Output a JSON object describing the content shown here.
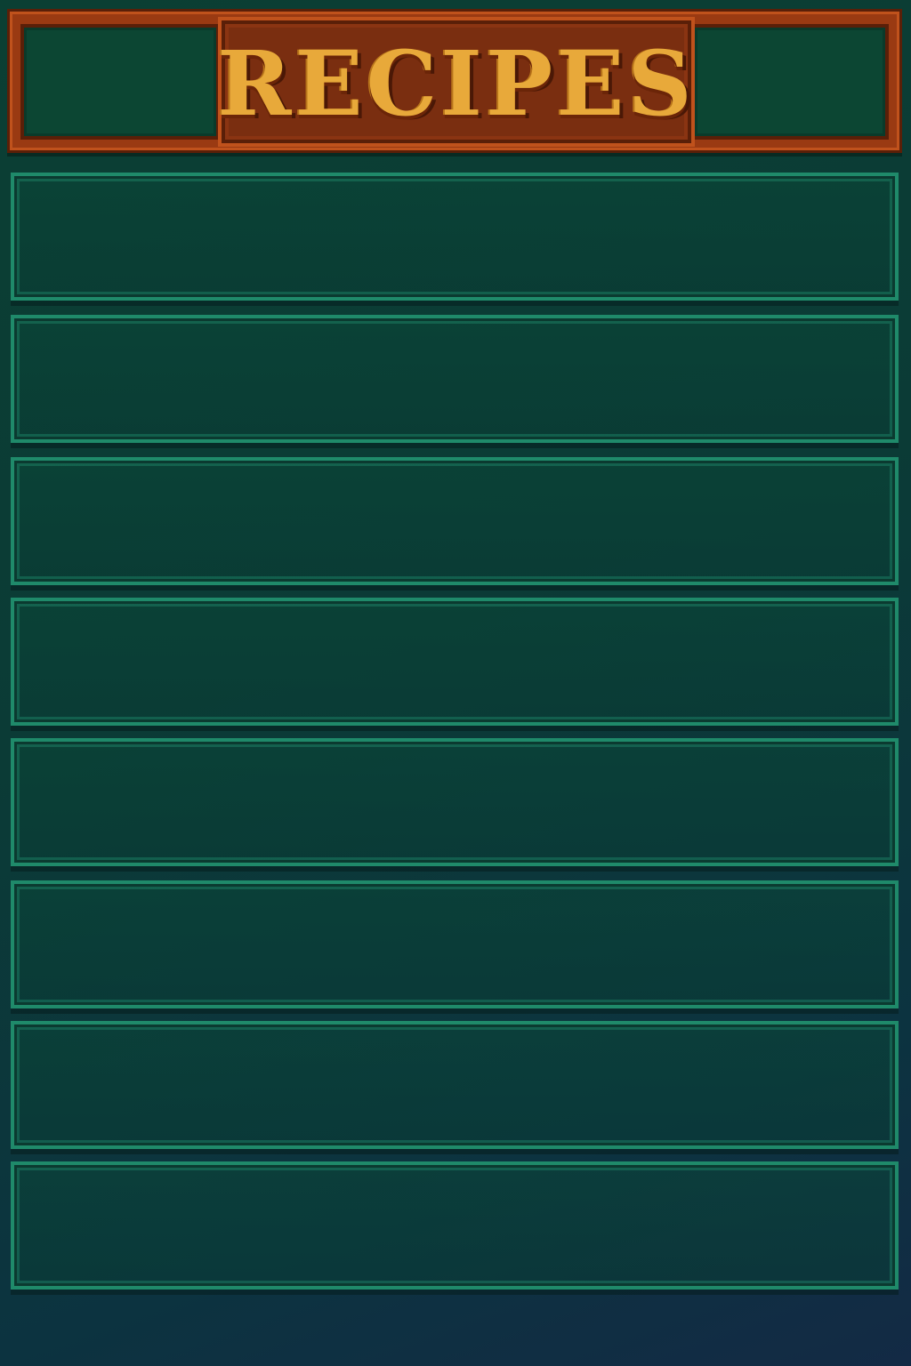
{
  "header": {
    "title": "RECIPES"
  },
  "recipes": {
    "slots": [
      {
        "label": ""
      },
      {
        "label": ""
      },
      {
        "label": ""
      },
      {
        "label": ""
      },
      {
        "label": ""
      },
      {
        "label": ""
      },
      {
        "label": ""
      },
      {
        "label": ""
      }
    ]
  },
  "colors": {
    "background": "#0b3f33",
    "header_frame": "#9a3a12",
    "title_text": "#e8a93a",
    "slot_border": "#1f8a6a"
  }
}
